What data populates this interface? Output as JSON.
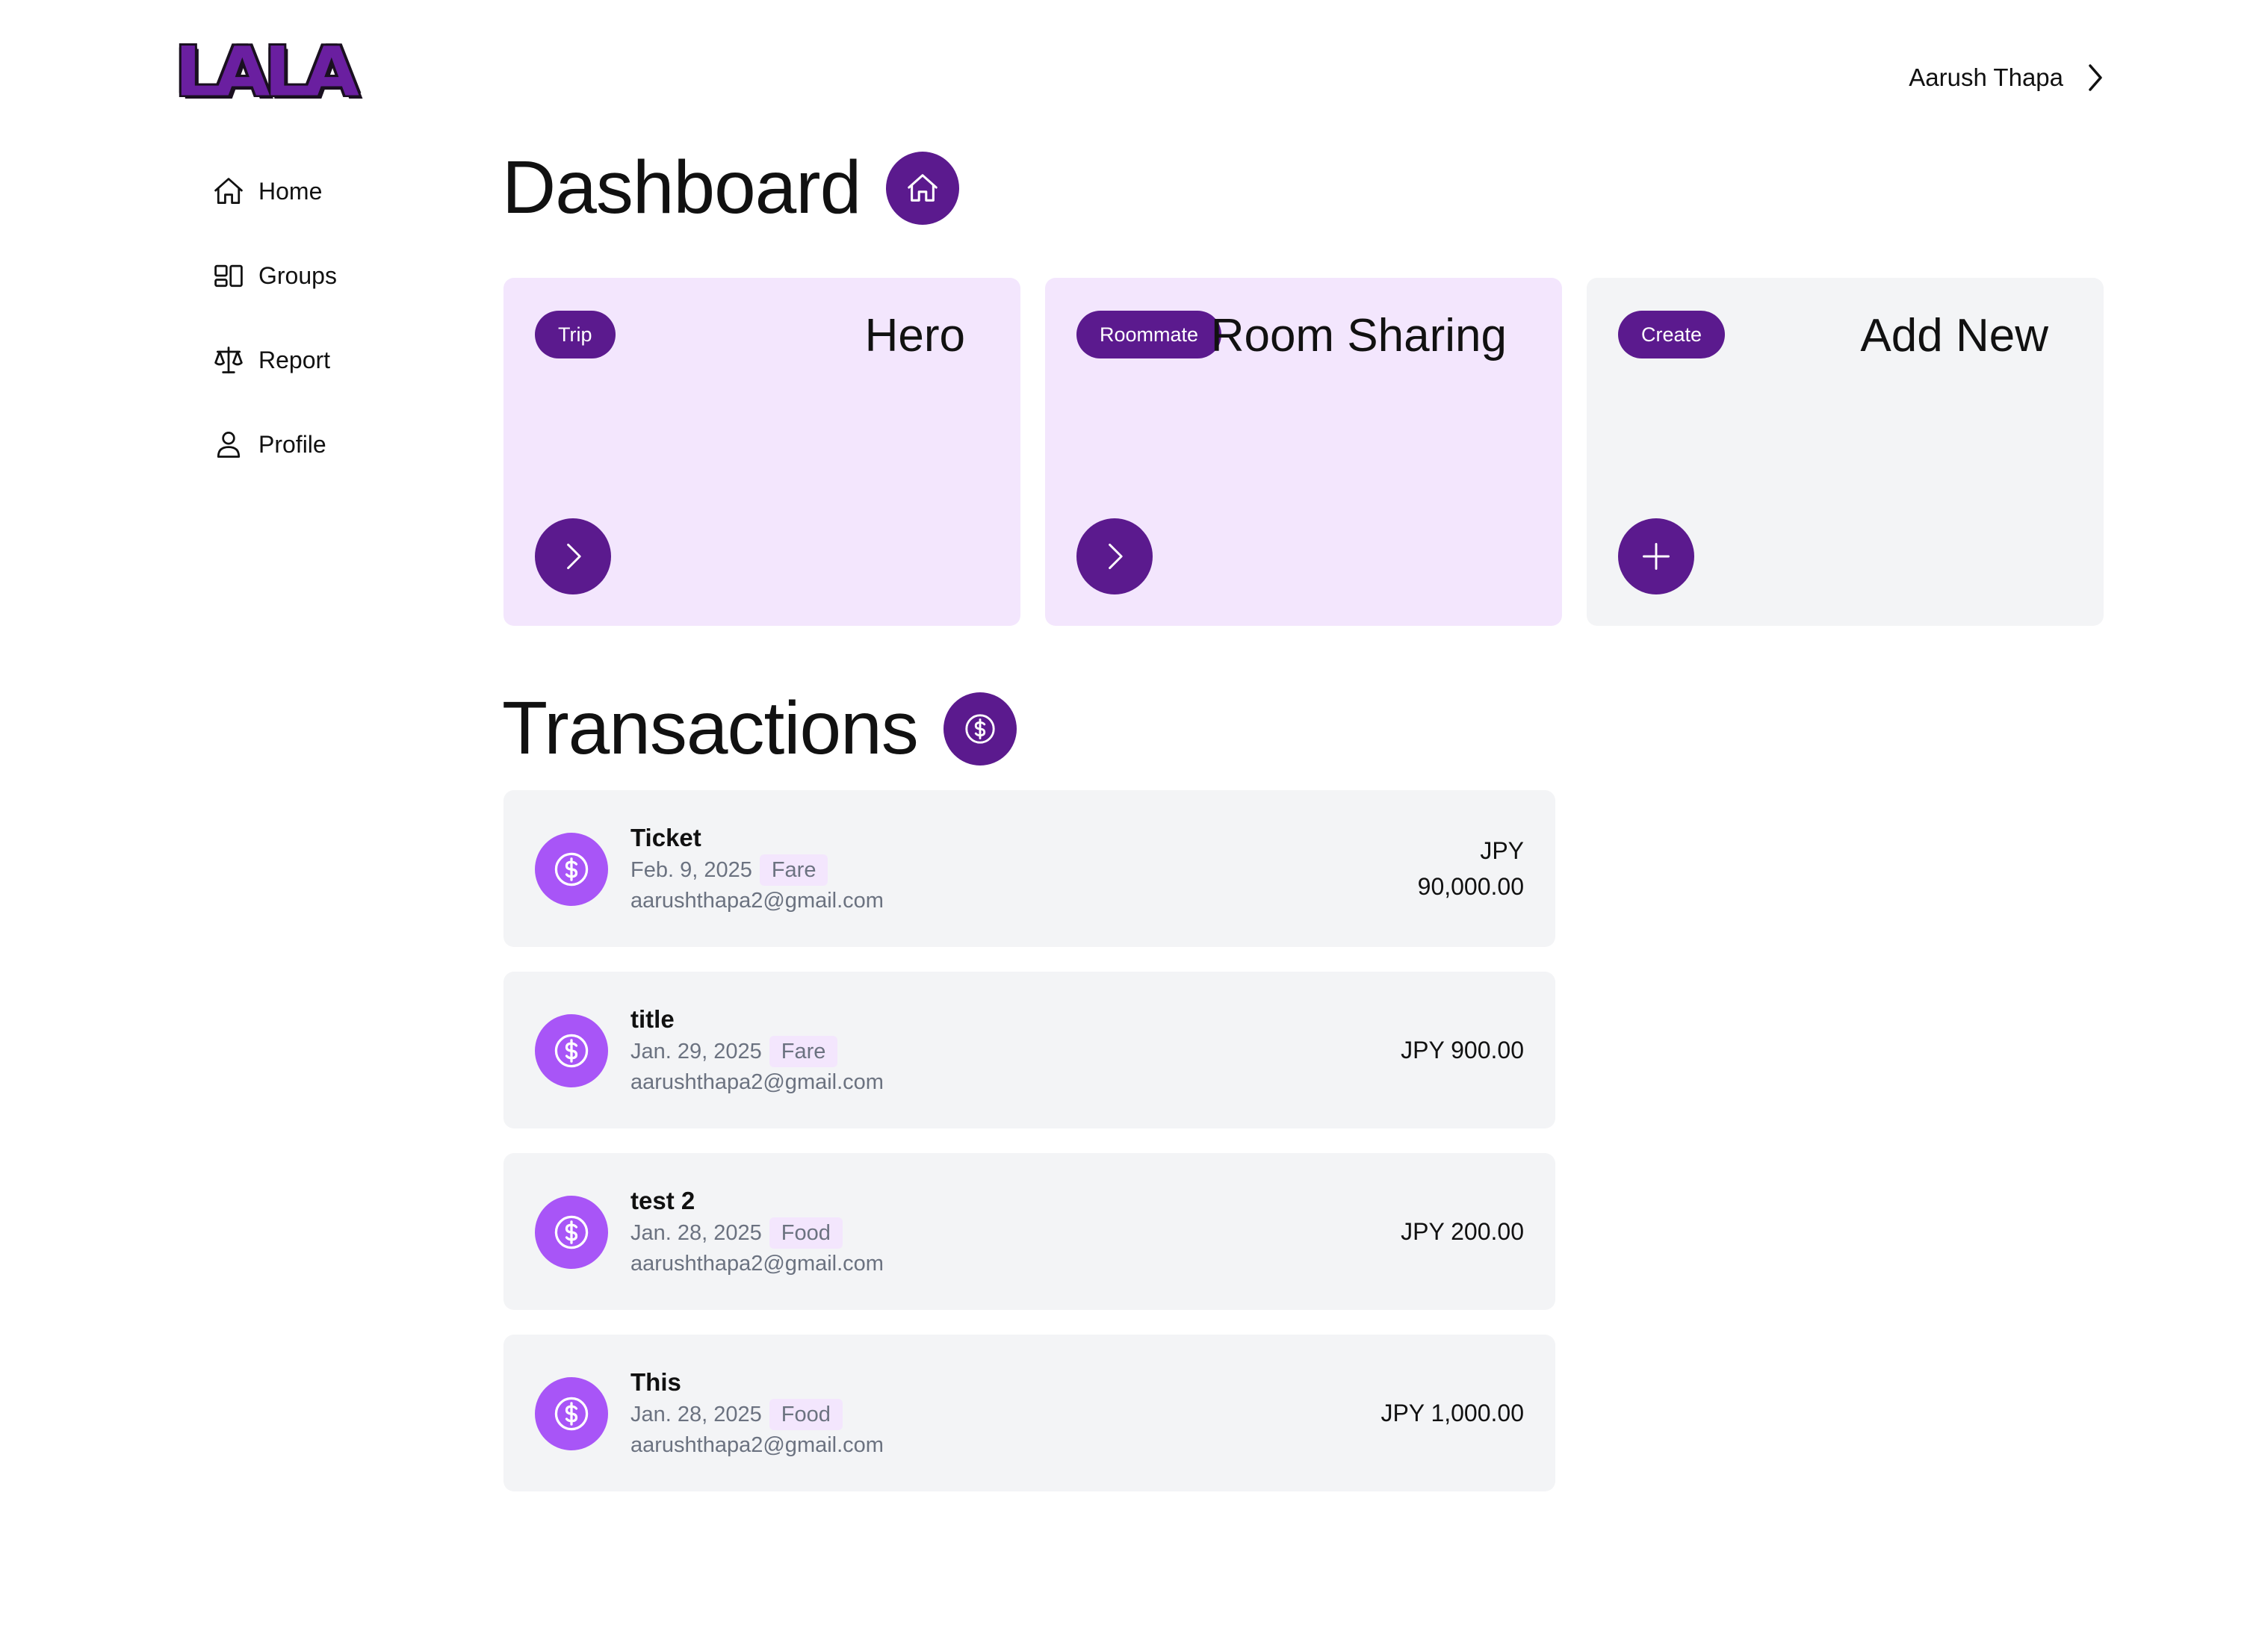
{
  "header": {
    "logo_text": "LALA",
    "user_name": "Aarush Thapa"
  },
  "sidebar": {
    "items": [
      {
        "label": "Home",
        "icon": "home-icon"
      },
      {
        "label": "Groups",
        "icon": "groups-icon"
      },
      {
        "label": "Report",
        "icon": "scale-icon"
      },
      {
        "label": "Profile",
        "icon": "user-icon"
      }
    ]
  },
  "dashboard": {
    "title": "Dashboard",
    "cards": [
      {
        "tag": "Trip",
        "title": "Hero",
        "action_icon": "chevron-right-icon"
      },
      {
        "tag": "Roommate",
        "title": "Room Sharing",
        "action_icon": "chevron-right-icon"
      },
      {
        "tag": "Create",
        "title": "Add New",
        "action_icon": "plus-icon"
      }
    ]
  },
  "transactions": {
    "title": "Transactions",
    "items": [
      {
        "title": "Ticket",
        "date": "Feb. 9, 2025",
        "category": "Fare",
        "email": "aarushthapa2@gmail.com",
        "amount_line1": "JPY",
        "amount_line2": "90,000.00"
      },
      {
        "title": "title",
        "date": "Jan. 29, 2025",
        "category": "Fare",
        "email": "aarushthapa2@gmail.com",
        "amount_line1": "JPY 900.00",
        "amount_line2": ""
      },
      {
        "title": "test 2",
        "date": "Jan. 28, 2025",
        "category": "Food",
        "email": "aarushthapa2@gmail.com",
        "amount_line1": "JPY 200.00",
        "amount_line2": ""
      },
      {
        "title": "This",
        "date": "Jan. 28, 2025",
        "category": "Food",
        "email": "aarushthapa2@gmail.com",
        "amount_line1": "JPY 1,000.00",
        "amount_line2": ""
      }
    ]
  },
  "colors": {
    "primary": "#5b1a8e",
    "card_purple": "#f3e6fd",
    "card_gray": "#f3f4f6",
    "tx_icon": "#a855f7"
  }
}
